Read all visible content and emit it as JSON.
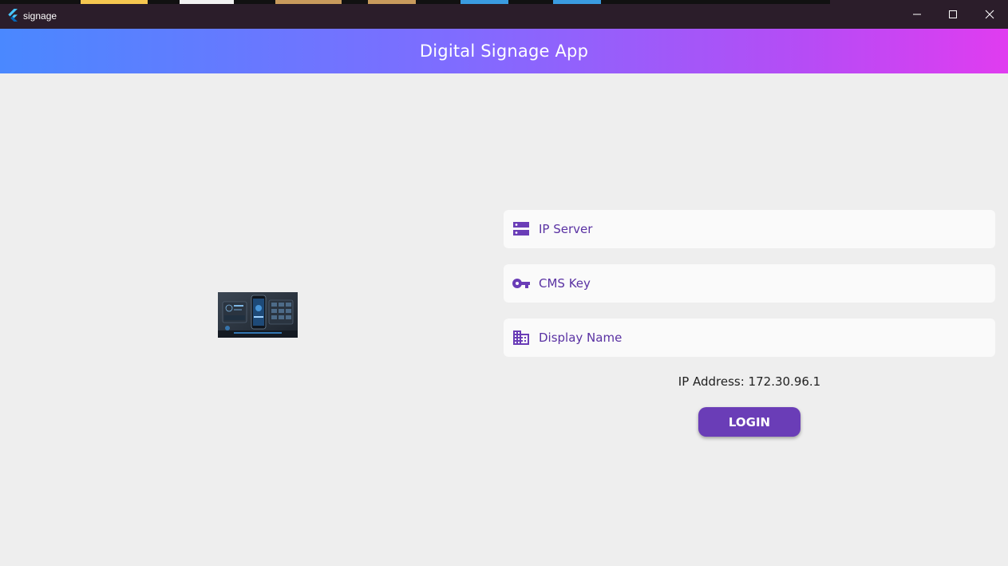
{
  "window": {
    "title": "signage",
    "icon": "flutter-icon",
    "controls": [
      "minimize-icon",
      "maximize-icon",
      "close-icon"
    ]
  },
  "appbar": {
    "title": "Digital Signage App",
    "gradient": [
      "#4a88ff",
      "#7f6cff",
      "#b64cf5",
      "#e03cf0"
    ]
  },
  "form": {
    "ip_server": {
      "placeholder": "IP Server",
      "value": "",
      "icon": "dns-icon"
    },
    "cms_key": {
      "placeholder": "CMS Key",
      "value": "",
      "icon": "key-icon"
    },
    "display_name": {
      "placeholder": "Display Name",
      "value": "",
      "icon": "business-icon"
    },
    "ip_address_text": "IP Address: 172.30.96.1",
    "login_label": "LOGIN"
  },
  "colors": {
    "accent": "#6a3db7",
    "field_text": "#5a32a3",
    "background": "#eeeeee",
    "titlebar": "#2b1d2a"
  }
}
